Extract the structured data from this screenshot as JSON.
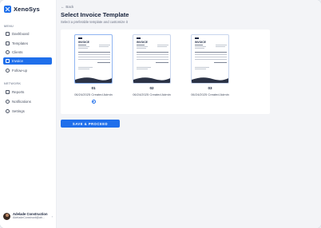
{
  "brand": {
    "name": "XenoSys"
  },
  "sidebar": {
    "menu_label": "MENU",
    "items": [
      {
        "label": "Dashboard",
        "icon": "grid-icon"
      },
      {
        "label": "Templates",
        "icon": "template-icon"
      },
      {
        "label": "Clients",
        "icon": "users-icon"
      },
      {
        "label": "Invoice",
        "icon": "invoice-icon",
        "active": true
      },
      {
        "label": "Follow-up",
        "icon": "followup-icon"
      }
    ],
    "network_label": "NETWORK",
    "network_items": [
      {
        "label": "Reports",
        "icon": "reports-icon"
      },
      {
        "label": "Notifications",
        "icon": "bell-icon"
      },
      {
        "label": "Settings",
        "icon": "gear-icon"
      }
    ],
    "user": {
      "name": "Adelade Construction",
      "email": "AdeladeConstructi@ab..."
    }
  },
  "page": {
    "back_label": "Back",
    "title": "Select Invoice Template",
    "subtitle": "Select a preferable template and customize it"
  },
  "templates": [
    {
      "number": "01",
      "date": "06/24/2025",
      "author": "Created Admin",
      "selected": true,
      "doc_title": "INVOICE"
    },
    {
      "number": "02",
      "date": "06/24/2025",
      "author": "Created Admin",
      "selected": false,
      "doc_title": "INVOICE"
    },
    {
      "number": "03",
      "date": "06/24/2025",
      "author": "Created Admin",
      "selected": false,
      "doc_title": "INVOICE"
    }
  ],
  "actions": {
    "proceed_label": "SAVE & PROCEED"
  },
  "colors": {
    "accent": "#1f6feb",
    "text": "#16213a",
    "muted": "#6c7385"
  }
}
